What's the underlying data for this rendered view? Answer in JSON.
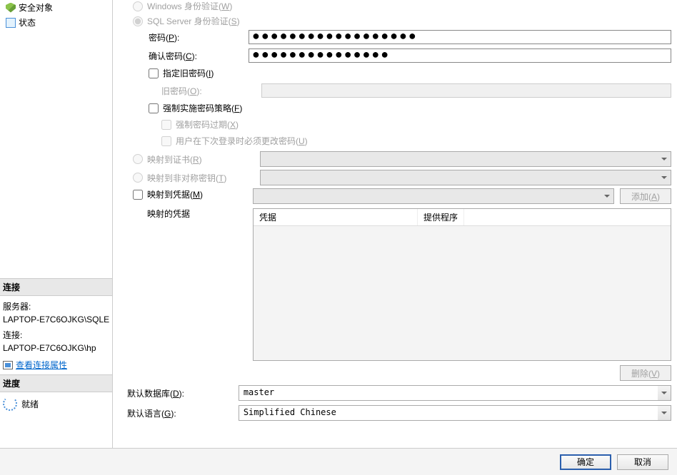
{
  "tree": {
    "security_objects": "安全对象",
    "status": "状态"
  },
  "auth": {
    "windows_auth": "Windows 身份验证(",
    "windows_auth_key": "W",
    "sql_auth": "SQL Server 身份验证(",
    "sql_auth_key": "S",
    "password_label": "密码(",
    "password_key": "P",
    "label_suffix": "):",
    "confirm_label": "确认密码(",
    "confirm_key": "C",
    "specify_old": "指定旧密码(",
    "specify_old_key": "I",
    "old_password_label": "旧密码(",
    "old_password_key": "O",
    "enforce_policy": "强制实施密码策略(",
    "enforce_policy_key": "F",
    "enforce_expire": "强制密码过期(",
    "enforce_expire_key": "X",
    "must_change": "用户在下次登录时必须更改密码(",
    "must_change_key": "U",
    "paren_close": ")"
  },
  "mapping": {
    "map_cert": "映射到证书(",
    "map_cert_key": "R",
    "map_asym": "映射到非对称密钥(",
    "map_asym_key": "T",
    "map_cred": "映射到凭据(",
    "map_cred_key": "M",
    "mapped_creds": "映射的凭据",
    "add_btn": "添加(",
    "add_key": "A",
    "delete_btn": "删除(",
    "delete_key": "V",
    "col_credential": "凭据",
    "col_provider": "提供程序"
  },
  "defaults": {
    "db_label": "默认数据库(",
    "db_key": "D",
    "db_value": "master",
    "lang_label": "默认语言(",
    "lang_key": "G",
    "lang_value": "Simplified Chinese"
  },
  "connection": {
    "header": "连接",
    "server_label": "服务器:",
    "server_value": "LAPTOP-E7C6OJKG\\SQLE",
    "conn_label": "连接:",
    "conn_value": "LAPTOP-E7C6OJKG\\hp",
    "view_props": "查看连接属性"
  },
  "progress": {
    "header": "进度",
    "ready": "就绪"
  },
  "buttons": {
    "ok": "确定",
    "cancel": "取消"
  },
  "password_dots_long": "●●●●●●●●●●●●●●●●●●",
  "password_dots_short": "●●●●●●●●●●●●●●●"
}
